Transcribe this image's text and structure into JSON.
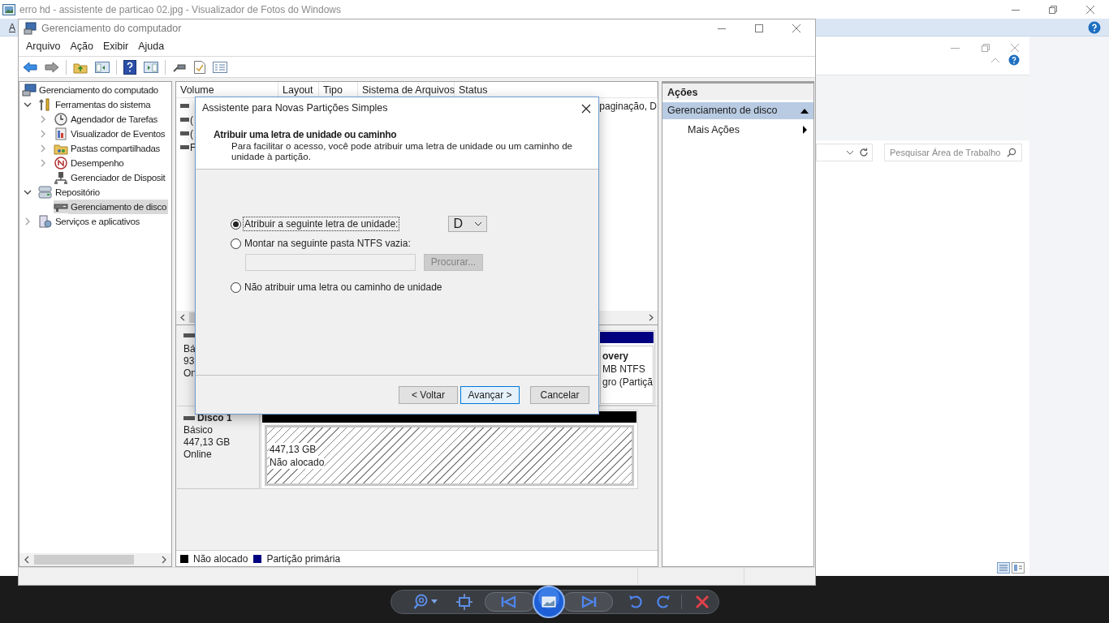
{
  "viewer": {
    "title": "erro hd - assistente de particao 02.jpg - Visualizador de Fotos do Windows"
  },
  "background_window": {
    "menu_fragment": "A",
    "search": {
      "placeholder": "Pesquisar Área de Trabalho"
    }
  },
  "window": {
    "title": "Gerenciamento do computador",
    "menu": [
      "Arquivo",
      "Ação",
      "Exibir",
      "Ajuda"
    ]
  },
  "tree": [
    {
      "label": "Gerenciamento do computado",
      "selected": false,
      "children": [
        {
          "label": "Ferramentas do sistema",
          "selected": false,
          "expanded": true,
          "children": [
            {
              "label": "Agendador de Tarefas",
              "selected": false,
              "expanded": false
            },
            {
              "label": "Visualizador de Eventos",
              "selected": false,
              "expanded": false
            },
            {
              "label": "Pastas compartilhadas",
              "selected": false,
              "expanded": false
            },
            {
              "label": "Desempenho",
              "selected": false,
              "expanded": false
            },
            {
              "label": "Gerenciador de Disposit",
              "selected": false
            }
          ]
        },
        {
          "label": "Repositório",
          "selected": false,
          "expanded": true,
          "children": [
            {
              "label": "Gerenciamento de disco",
              "selected": true
            }
          ]
        },
        {
          "label": "Serviços e aplicativos",
          "selected": false,
          "expanded": false
        }
      ]
    }
  ],
  "table": {
    "columns": [
      "Volume",
      "Layout",
      "Tipo",
      "Sistema de Arquivos",
      "Status"
    ],
    "rows": [
      {
        "status": "paginação, D"
      },
      {
        "volume": "("
      },
      {
        "volume": "("
      },
      {
        "volume": "F"
      }
    ]
  },
  "disks": [
    {
      "lines": [
        "Bá",
        "93",
        "On"
      ],
      "partition": {
        "kind": "primary",
        "title": "overy",
        "lines": [
          "MB NTFS",
          "gro (Partiçã"
        ]
      }
    },
    {
      "name": "Disco 1",
      "lines": [
        "Básico",
        "447,13 GB",
        "Online"
      ],
      "partition": {
        "kind": "unallocated",
        "lines": [
          "447,13 GB",
          "Não alocado"
        ]
      }
    }
  ],
  "legend": [
    {
      "label": "Não alocado",
      "color": "#000000"
    },
    {
      "label": "Partição primária",
      "color": "#000080"
    }
  ],
  "actions": {
    "title": "Ações",
    "sections": [
      {
        "label": "Gerenciamento de disco",
        "expanded": true,
        "items": [
          "Mais Ações"
        ]
      }
    ]
  },
  "dialog": {
    "title": "Assistente para Novas Partições Simples",
    "heading": "Atribuir uma letra de unidade ou caminho",
    "description": "Para facilitar o acesso, você pode atribuir uma letra de unidade ou um caminho de unidade à partição.",
    "options": [
      {
        "kind": "letter",
        "label": "Atribuir a seguinte letra de unidade:",
        "selected": true,
        "value": "D"
      },
      {
        "kind": "folder",
        "label": "Montar na seguinte pasta NTFS vazia:",
        "selected": false,
        "disabled": true,
        "button": "Procurar..."
      },
      {
        "kind": "none",
        "label": "Não atribuir uma letra ou caminho de unidade",
        "selected": false
      }
    ],
    "buttons": [
      {
        "label": "< Voltar",
        "default": false
      },
      {
        "label": "Avançar >",
        "default": true
      },
      {
        "label": "Cancelar",
        "default": false
      }
    ]
  }
}
